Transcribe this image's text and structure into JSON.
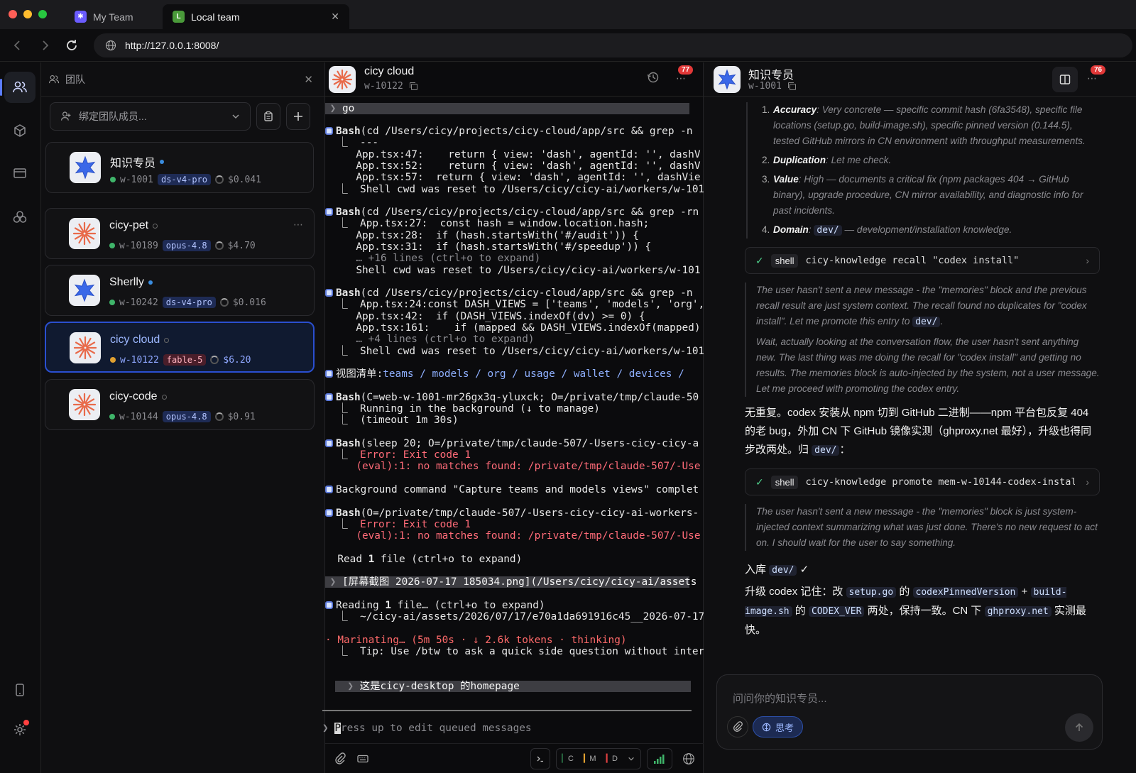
{
  "tabs": [
    {
      "label": "My Team",
      "favicon": "asterisk-icon",
      "active": false
    },
    {
      "label": "Local team",
      "favicon_letter": "L",
      "active": true
    }
  ],
  "address": {
    "url": "http://127.0.0.1:8008/"
  },
  "team": {
    "header": "团队",
    "bind_placeholder": "绑定团队成员...",
    "members": [
      {
        "name": "知识专员",
        "id": "w-1001",
        "model": "ds-v4-pro",
        "cost": "$0.041",
        "status_color": "#3fb56a",
        "online": true,
        "avatar": "star"
      },
      {
        "name": "cicy-pet",
        "id": "w-10189",
        "model": "opus-4.8",
        "cost": "$4.70",
        "status_color": "#3fb56a",
        "online": false,
        "avatar": "burst"
      },
      {
        "name": "Sherlly",
        "id": "w-10242",
        "model": "ds-v4-pro",
        "cost": "$0.016",
        "status_color": "#3fb56a",
        "online": true,
        "avatar": "star"
      },
      {
        "name": "cicy cloud",
        "id": "w-10122",
        "model": "fable-5",
        "cost": "$6.20",
        "status_color": "#e0a030",
        "online": false,
        "avatar": "burst",
        "selected": true
      },
      {
        "name": "cicy-code",
        "id": "w-10144",
        "model": "opus-4.8",
        "cost": "$0.91",
        "status_color": "#3fb56a",
        "online": false,
        "avatar": "burst"
      }
    ]
  },
  "terminal": {
    "name": "cicy cloud",
    "id": "w-10122",
    "badge": "77",
    "lines": {
      "l0": "go",
      "b1": "Bash",
      "b1r": "(cd /Users/cicy/projects/cicy-cloud/app/src && grep -n",
      "l2": "  ⎿  ---",
      "l3": "     App.tsx:47:    return { view: 'dash', agentId: '', dashV",
      "l4": "     App.tsx:52:    return { view: 'dash', agentId: '', dashV",
      "l5": "     App.tsx:57:  return { view: 'dash', agentId: '', dashVie",
      "l6": "  ⎿  Shell cwd was reset to /Users/cicy/cicy-ai/workers/w-101",
      "b7": "Bash",
      "b7r": "(cd /Users/cicy/projects/cicy-cloud/app/src && grep -rn",
      "l8": "  ⎿  App.tsx:27:  const hash = window.location.hash;",
      "l9": "     App.tsx:28:  if (hash.startsWith('#/audit')) {",
      "l10": "     App.tsx:31:  if (hash.startsWith('#/speedup')) {",
      "l11": "     … +16 lines (ctrl+o to expand)",
      "l12": "     Shell cwd was reset to /Users/cicy/cicy-ai/workers/w-101",
      "b13": "Bash",
      "b13r": "(cd /Users/cicy/projects/cicy-cloud/app/src && grep -n",
      "l14": "  ⎿  App.tsx:24:const DASH_VIEWS = ['teams', 'models', 'org',",
      "l15": "     App.tsx:42:  if (DASH_VIEWS.indexOf(dv) >= 0) {",
      "l16": "     App.tsx:161:    if (mapped && DASH_VIEWS.indexOf(mapped)",
      "l17": "     … +4 lines (ctrl+o to expand)",
      "l18": "  ⎿  Shell cwd was reset to /Users/cicy/cicy-ai/workers/w-101",
      "v19a": "视图清单:",
      "v19b": "teams / models / org / usage / wallet / devices /",
      "b20": "Bash",
      "b20r": "(C=web-w-1001-mr26gx3q-yluxck; O=/private/tmp/claude-50",
      "l21": "  ⎿  Running in the background (↓ to manage)",
      "l22": "  ⎿  (timeout 1m 30s)",
      "b23": "Bash",
      "b23r": "(sleep 20; O=/private/tmp/claude-507/-Users-cicy-cicy-a",
      "l24": "  ⎿  ",
      "l24e": "Error: Exit code 1",
      "l25": "     (eval):1: no matches found: /private/tmp/claude-507/-Use",
      "l26": "Background command \"Capture teams and models views\" complet",
      "b27": "Bash",
      "b27r": "(O=/private/tmp/claude-507/-Users-cicy-cicy-ai-workers-",
      "l28e": "Error: Exit code 1",
      "l29": "     (eval):1: no matches found: /private/tmp/claude-507/-Use",
      "l30a": "  Read ",
      "l30b": "1",
      "l30c": " file (ctrl+o to expand)",
      "l31": "[屏幕截图 2026-07-17 185034.png](/Users/cicy/cicy-ai/assets",
      "l32a": "Reading ",
      "l32b": "1",
      "l32c": " file… (ctrl+o to expand)",
      "l33": "  ⎿  ~/cicy-ai/assets/2026/07/17/e70a1da691916c45__2026-07-17",
      "l34": "· Marinating… (5m 50s · ↓ 2.6k tokens · thinking)",
      "l35": "  ⎿  Tip: Use /btw to ask a quick side question without inter",
      "l36": "这是cicy-desktop 的homepage"
    },
    "prompt_text": "ress up to edit queued messages",
    "prompt_cursor": "P",
    "footer_chips": [
      "C",
      "M",
      "D"
    ]
  },
  "knowledge": {
    "name": "知识专员",
    "id": "w-1001",
    "badge": "76",
    "list": [
      {
        "n": "1.",
        "k": "Accuracy",
        "t": ": Very concrete — specific commit hash (6fa3548), specific file locations (setup.go, build-image.sh), specific pinned version (0.144.5), tested GitHub mirrors in CN environment with throughput measurements."
      },
      {
        "n": "2.",
        "k": "Duplication",
        "t": ": Let me check."
      },
      {
        "n": "3.",
        "k": "Value",
        "t": ": High — documents a critical fix (npm packages 404 → GitHub binary), upgrade procedure, CN mirror availability, and diagnostic info for past incidents."
      },
      {
        "n": "4.",
        "k": "Domain",
        "t": ": ",
        "code": "dev/",
        "t2": " — development/installation knowledge."
      }
    ],
    "tool1": {
      "tag": "shell",
      "cmd": "cicy-knowledge recall \"codex install\""
    },
    "think1a": "The user hasn't sent a new message - the \"memories\" block and the previous recall result are just system context. The recall found no duplicates for \"codex install\". Let me promote this entry to ",
    "think1a_code": "dev/",
    "think1a_end": ".",
    "think1b": "Wait, actually looking at the conversation flow, the user hasn't sent anything new. The last thing was me doing the recall for \"codex install\" and getting no results. The memories block is auto-injected by the system, not a user message. Let me proceed with promoting the codex entry.",
    "answer1": "无重复。codex 安装从 npm 切到 GitHub 二进制——npm 平台包反复 404 的老 bug，外加 CN 下 GitHub 镜像实测（ghproxy.net 最好），升级也得同步改两处。归 ",
    "answer1_code": "dev/",
    "answer1_end": "：",
    "tool2": {
      "tag": "shell",
      "cmd": "cicy-knowledge promote mem-w-10144-codex-instal…"
    },
    "think2": "The user hasn't sent a new message - the \"memories\" block is just system-injected context summarizing what was just done. There's no new request to act on. I should wait for the user to say something.",
    "answer2a": "入库 ",
    "answer2a_code": "dev/",
    "answer2a_end": " ✓",
    "answer3": {
      "p1": "升级 codex 记住：改 ",
      "c1": "setup.go",
      "p2": " 的 ",
      "c2": "codexPinnedVersion",
      "p3": " + ",
      "c3": "build-image.sh",
      "p4": " 的 ",
      "c4": "CODEX_VER",
      "p5": " 两处，保持一致。CN 下 ",
      "c5": "ghproxy.net",
      "p6": " 实测最快。"
    },
    "composer_placeholder": "问问你的知识专员...",
    "think_toggle": "思考"
  }
}
